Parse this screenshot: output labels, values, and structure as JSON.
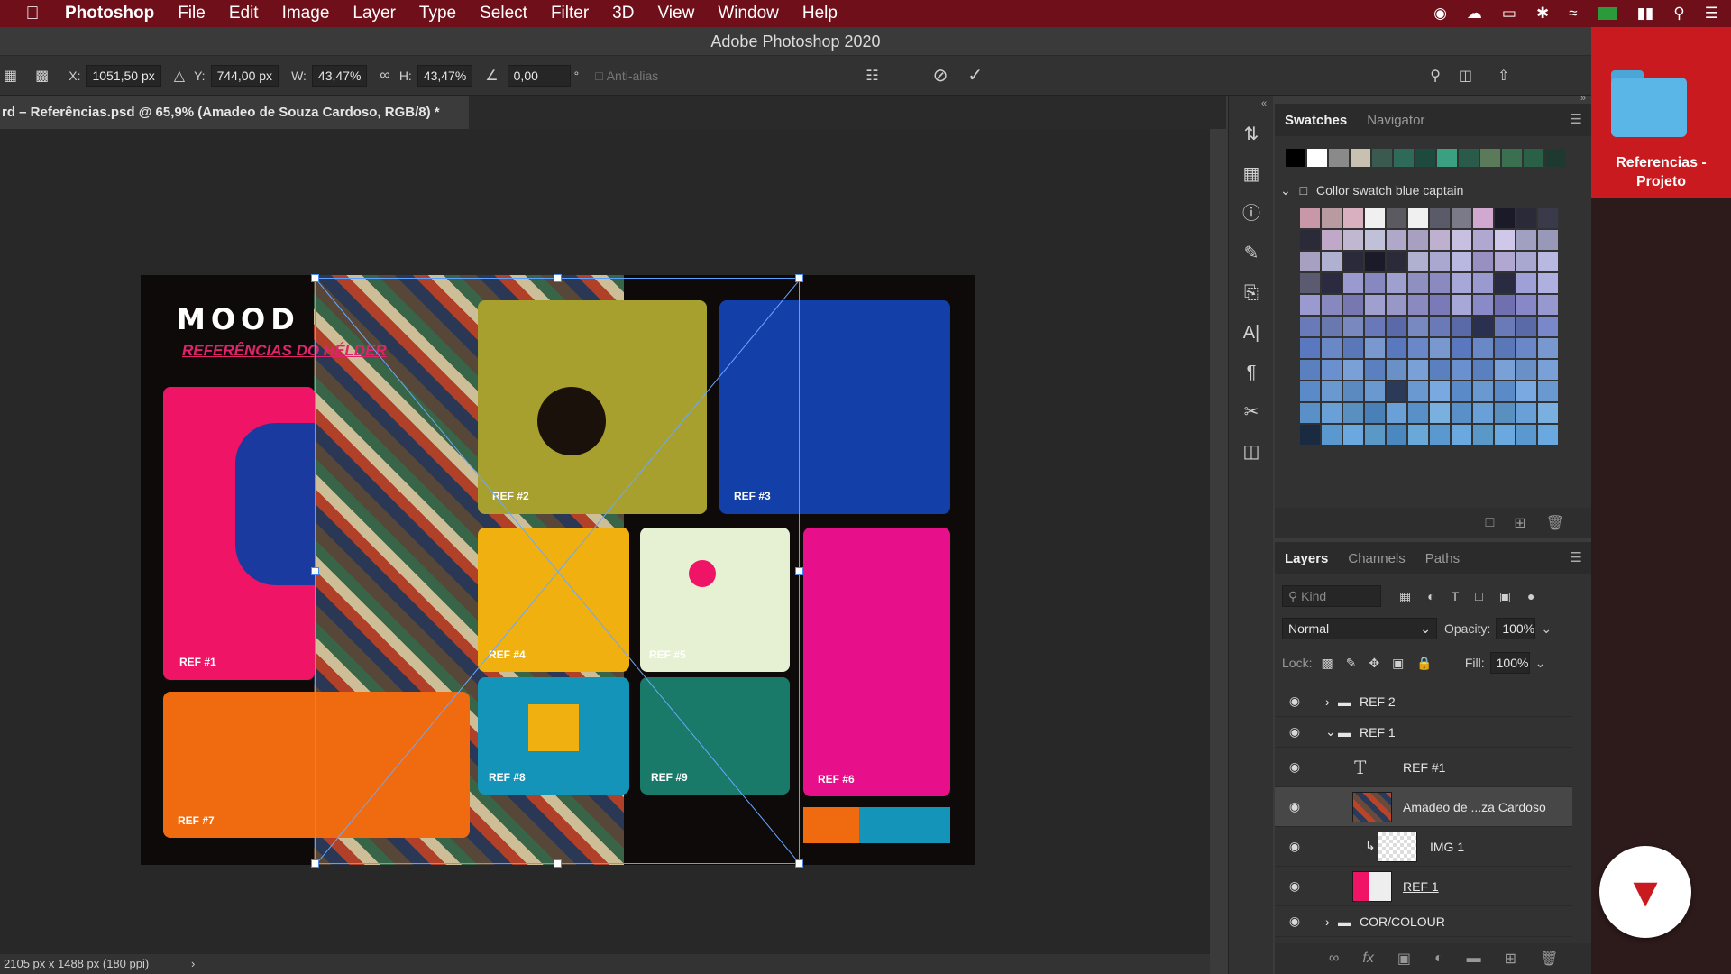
{
  "menubar": {
    "app_name": "Photoshop",
    "items": [
      "File",
      "Edit",
      "Image",
      "Layer",
      "Type",
      "Select",
      "Filter",
      "3D",
      "View",
      "Window",
      "Help"
    ],
    "status_icons": [
      "record-icon",
      "creative-cloud-icon",
      "airplay-icon",
      "bluetooth-icon",
      "wifi-icon",
      "flag-icon",
      "battery-icon",
      "search-icon",
      "control-center-icon"
    ]
  },
  "window": {
    "title": "Adobe Photoshop 2020"
  },
  "options_bar": {
    "x_label": "X:",
    "x_value": "1051,50 px",
    "y_label": "Y:",
    "y_value": "744,00 px",
    "w_label": "W:",
    "w_value": "43,47%",
    "h_label": "H:",
    "h_value": "43,47%",
    "angle_value": "0,00",
    "angle_unit": "°",
    "antialias_label": "Anti-alias"
  },
  "document": {
    "tab_title": "rd – Referências.psd @ 65,9% (Amadeo de Souza Cardoso, RGB/8) *",
    "status": "2105 px x 1488 px (180 ppi)"
  },
  "artwork": {
    "title": "MOOD",
    "subtitle": "REFERÊNCIAS DO HÉLDER",
    "refs": [
      "REF #1",
      "REF #2",
      "REF #3",
      "REF #4",
      "REF #5",
      "REF #6",
      "REF #7",
      "REF #8",
      "REF #9"
    ]
  },
  "swatches_panel": {
    "tabs": [
      "Swatches",
      "Navigator"
    ],
    "group_name": "Collor swatch blue captain",
    "top_colors": [
      "#000000",
      "#ffffff",
      "#8a8a8a",
      "#c8c0b0",
      "#3a5a50",
      "#2e6a58",
      "#1e4a3e",
      "#3aa080",
      "#2a5a4a",
      "#5a7a5a",
      "#3a7050",
      "#2a6048",
      "#1e3a30"
    ],
    "grid_colors": [
      "#c898a8",
      "#b89aa0",
      "#d8b0c0",
      "#f0f0f0",
      "#5a5a60",
      "#f0f0f0",
      "#5a5a68",
      "#7a7a88",
      "#d0a8d0",
      "#1a1a28",
      "#2a2a38",
      "#3a3a4a",
      "#2a2a38",
      "#c0a8c8",
      "#c0b8d0",
      "#c0c0d8",
      "#b0a8c8",
      "#a8a0c0",
      "#c0b0d0",
      "#c8c0e0",
      "#b0a8d0",
      "#d0c8e8",
      "#a0a0c0",
      "#9898b8",
      "#a8a0c0",
      "#b0b0d0",
      "#2a2a3a",
      "#1a1a28",
      "#2a2a38",
      "#b0b0d0",
      "#a8a8d0",
      "#b8b8e0",
      "#9890c0",
      "#b0a8d0",
      "#a8a8d0",
      "#b8b8e0",
      "#5a5a70",
      "#2a2a40",
      "#9a9ad0",
      "#8888c0",
      "#a0a0d0",
      "#9090c0",
      "#8a8ac0",
      "#a8a8d8",
      "#9a9ad0",
      "#2a2a40",
      "#a0a0d8",
      "#b0b0e0",
      "#9a9ad0",
      "#8888c0",
      "#7878b0",
      "#a0a0d0",
      "#9898c8",
      "#8a8ac0",
      "#7a7ab8",
      "#a8a8d8",
      "#8a8ac8",
      "#7070b0",
      "#8888c8",
      "#9898d0",
      "#6a7ab8",
      "#6a78b0",
      "#7a88c0",
      "#6878b8",
      "#5a6aa8",
      "#7888c0",
      "#6a7ab8",
      "#5a6aa8",
      "#2a3050",
      "#6a7ab8",
      "#5a6aa8",
      "#7888c8",
      "#5a78c0",
      "#6a88c8",
      "#5a78b8",
      "#7a98d0",
      "#5a78c0",
      "#6a88c8",
      "#7a98d0",
      "#5a78c0",
      "#6a88c8",
      "#5a78b8",
      "#6a88c8",
      "#7a98d0",
      "#5a80c0",
      "#6a90d0",
      "#7aa0d8",
      "#5a80c0",
      "#6a90c8",
      "#7aa0d8",
      "#5a80c0",
      "#6a90d0",
      "#5a80c0",
      "#7aa0d8",
      "#6a90c8",
      "#7aa0d8",
      "#5a8ac8",
      "#6a98d0",
      "#5a8ac0",
      "#6a98d0",
      "#2a3a58",
      "#6a98d0",
      "#7aa8e0",
      "#5a8ac8",
      "#6a98d0",
      "#5a8ac8",
      "#7aa8e0",
      "#6a98d0",
      "#5a90c8",
      "#6aa0d8",
      "#5a90c0",
      "#4a80b8",
      "#6aa0d8",
      "#5a90c8",
      "#7ab0e0",
      "#5a90c8",
      "#6aa0d8",
      "#5a90c0",
      "#6aa0d8",
      "#7ab0e0",
      "#1a2a40",
      "#5a98d0",
      "#6aa8e0",
      "#5a98c8",
      "#4a88c0",
      "#6aa8d8",
      "#5a98d0",
      "#6aa8e0",
      "#5a98c8",
      "#6aa8e0",
      "#5a98d0",
      "#6aa8e0"
    ]
  },
  "layers_panel": {
    "tabs": [
      "Layers",
      "Channels",
      "Paths"
    ],
    "filter_placeholder": "Kind",
    "blend_mode": "Normal",
    "opacity_label": "Opacity:",
    "opacity_value": "100%",
    "lock_label": "Lock:",
    "fill_label": "Fill:",
    "fill_value": "100%",
    "layers": [
      {
        "name": "REF 2",
        "kind": "group",
        "expanded": false,
        "indent": 0
      },
      {
        "name": "REF 1",
        "kind": "group",
        "expanded": true,
        "indent": 0
      },
      {
        "name": "REF #1",
        "kind": "text",
        "indent": 1
      },
      {
        "name": "Amadeo de ...za Cardoso",
        "kind": "image",
        "indent": 1,
        "selected": true
      },
      {
        "name": "IMG 1",
        "kind": "image",
        "indent": 2,
        "clipped": true
      },
      {
        "name": "REF 1",
        "kind": "shape",
        "indent": 1
      },
      {
        "name": "COR/COLOUR",
        "kind": "group",
        "expanded": false,
        "indent": 0
      }
    ]
  },
  "desktop": {
    "folder_label": "Referencias - Projeto",
    "accent": "#c81a1f"
  }
}
